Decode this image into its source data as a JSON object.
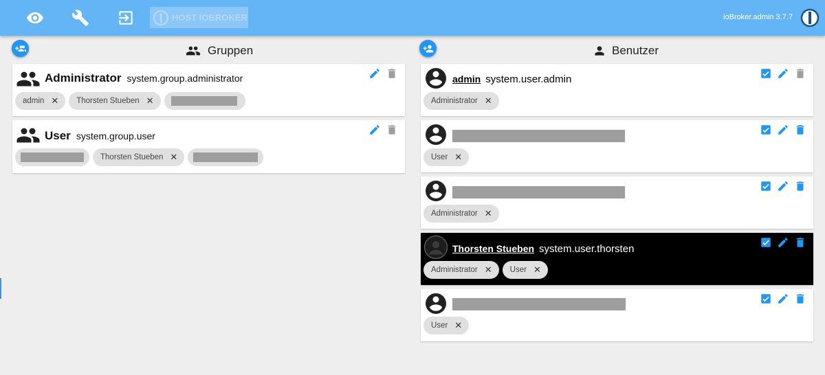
{
  "header": {
    "host_label": "HOST IOBROKER",
    "version": "ioBroker.admin 3.7.7",
    "icons": [
      "eye-icon",
      "wrench-icon",
      "logout-icon"
    ],
    "accent": "#64b5f6"
  },
  "groups": {
    "title": "Gruppen",
    "items": [
      {
        "name": "Administrator",
        "id": "system.group.administrator",
        "chips": [
          {
            "label": "admin"
          },
          {
            "label": "Thorsten Stueben"
          },
          {
            "label": ""
          }
        ]
      },
      {
        "name": "User",
        "id": "system.group.user",
        "chips": [
          {
            "label": ""
          },
          {
            "label": "Thorsten Stueben"
          },
          {
            "label": ""
          }
        ]
      }
    ]
  },
  "users": {
    "title": "Benutzer",
    "items": [
      {
        "name": "admin",
        "id": "system.user.admin",
        "chips": [
          {
            "label": "Administrator"
          }
        ]
      },
      {
        "name": "",
        "id": "",
        "chips": [
          {
            "label": "User"
          }
        ]
      },
      {
        "name": "",
        "id": "",
        "chips": [
          {
            "label": "Administrator"
          }
        ]
      },
      {
        "name": "Thorsten Stueben",
        "id": "system.user.thorsten",
        "chips": [
          {
            "label": "Administrator"
          },
          {
            "label": "User"
          }
        ]
      },
      {
        "name": "",
        "id": "",
        "chips": [
          {
            "label": "User"
          }
        ]
      }
    ]
  },
  "colors": {
    "action_blue": "#2196f3",
    "delete_grey": "#9e9e9e"
  }
}
